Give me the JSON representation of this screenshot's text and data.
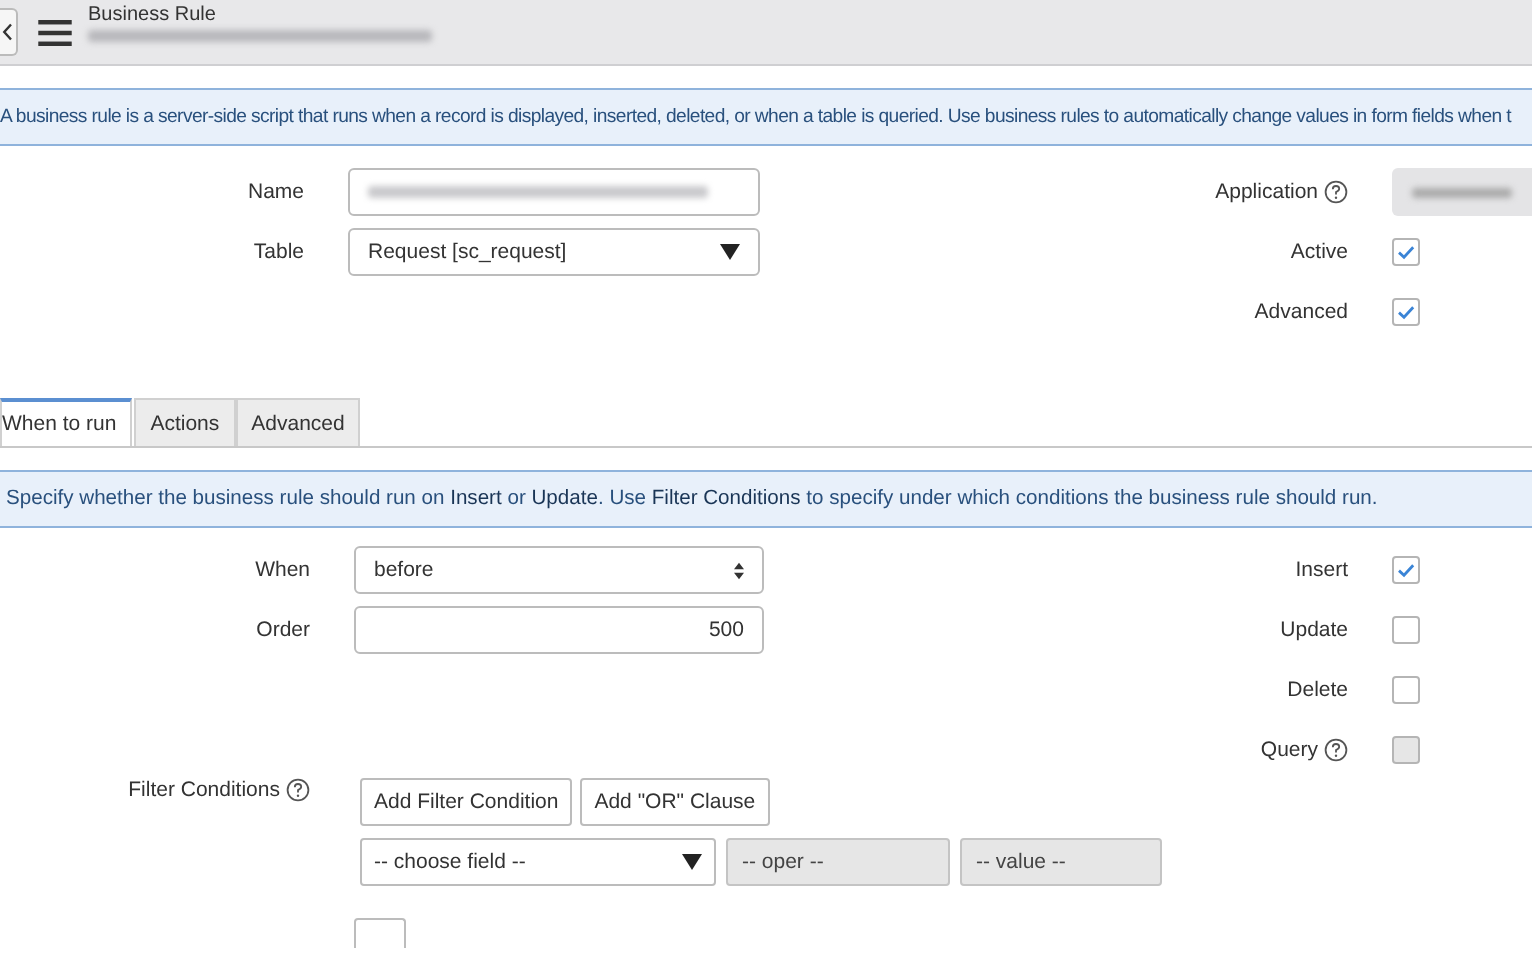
{
  "header": {
    "title": "Business Rule"
  },
  "intro": "A business rule is a server-side script that runs when a record is displayed, inserted, deleted, or when a table is queried. Use business rules to automatically change values in form fields when t",
  "fields": [
    {
      "label": "Name",
      "kind": "blurred"
    },
    {
      "label": "Table",
      "kind": "select",
      "value": "Request [sc_request]"
    }
  ],
  "side": [
    {
      "label": "Application",
      "help": true,
      "kind": "blurred"
    },
    {
      "label": "Active",
      "kind": "checkbox",
      "checked": true,
      "disabled": false
    },
    {
      "label": "Advanced",
      "kind": "checkbox",
      "checked": true,
      "disabled": false
    }
  ],
  "tabs": [
    {
      "label": "When to run",
      "selected": true
    },
    {
      "label": "Actions",
      "selected": false
    },
    {
      "label": "Advanced",
      "selected": false
    }
  ],
  "when_info": "Specify whether the business rule should run on **Insert** or **Update**. Use **Filter Conditions** to specify under which conditions the business rule should run.",
  "when_fields": [
    {
      "label": "When",
      "kind": "spinner",
      "value": "before"
    },
    {
      "label": "Order",
      "kind": "number",
      "value": "500"
    }
  ],
  "operations": [
    {
      "label": "Insert",
      "checked": true,
      "disabled": false
    },
    {
      "label": "Update",
      "checked": false,
      "disabled": false
    },
    {
      "label": "Delete",
      "checked": false,
      "disabled": false
    },
    {
      "label": "Query",
      "help": true,
      "checked": false,
      "disabled": true
    }
  ],
  "filter": {
    "label": "Filter Conditions",
    "help": true,
    "buttons": [
      "Add Filter Condition",
      "Add \"OR\" Clause"
    ],
    "field": "-- choose field --",
    "operator": "-- oper --",
    "value": "-- value --"
  }
}
